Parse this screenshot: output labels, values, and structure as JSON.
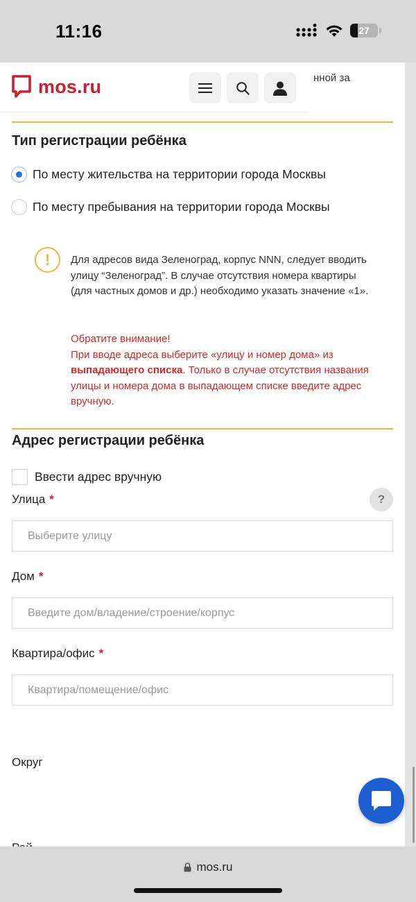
{
  "status_bar": {
    "time": "11:16",
    "battery": "27",
    "battery_level": 0.27
  },
  "header": {
    "logo_text": "mos.ru",
    "peek_text": "нной за"
  },
  "registration_type": {
    "title": "Тип регистрации ребёнка",
    "options": [
      {
        "label": "По месту жительства на территории города Москвы",
        "selected": true
      },
      {
        "label": "По месту пребывания на территории города Москвы",
        "selected": false
      }
    ]
  },
  "notice": {
    "icon": "exclamation-icon",
    "text": "Для адресов вида Зеленоград, корпус NNN, следует вводить улицу “Зеленоград”. В случае отсутствия номера квартиры (для частных домов и др.) необходимо указать значение «1».",
    "alert_title": "Обратите внимание!",
    "alert_line1": "При вводе адреса выберите «улицу и номер дома» из",
    "alert_bold": "выпадающего списка",
    "alert_rest": ". Только в случае отсутствия названия улицы и номера дома в выпадающем списке введите адрес вручную."
  },
  "address": {
    "title": "Адрес регистрации ребёнка",
    "manual_label": "Ввести адрес вручную",
    "street": {
      "label": "Улица",
      "required_mark": "*",
      "placeholder": "Выберите улицу"
    },
    "help": "?",
    "house": {
      "label": "Дом",
      "required_mark": "*",
      "placeholder": "Введите дом/владение/строение/корпус"
    },
    "apartment": {
      "label": "Квартира/офис",
      "required_mark": "*",
      "placeholder": "Квартира/помещение/офис"
    },
    "district_label": "Округ",
    "cut_label": "Рай"
  },
  "browser": {
    "url": "mos.ru"
  },
  "colors": {
    "brand_red": "#cc1f2d",
    "accent_yellow": "#f0b73f",
    "alert_red": "#cf2a2a",
    "link_blue": "#1d5fd0"
  }
}
